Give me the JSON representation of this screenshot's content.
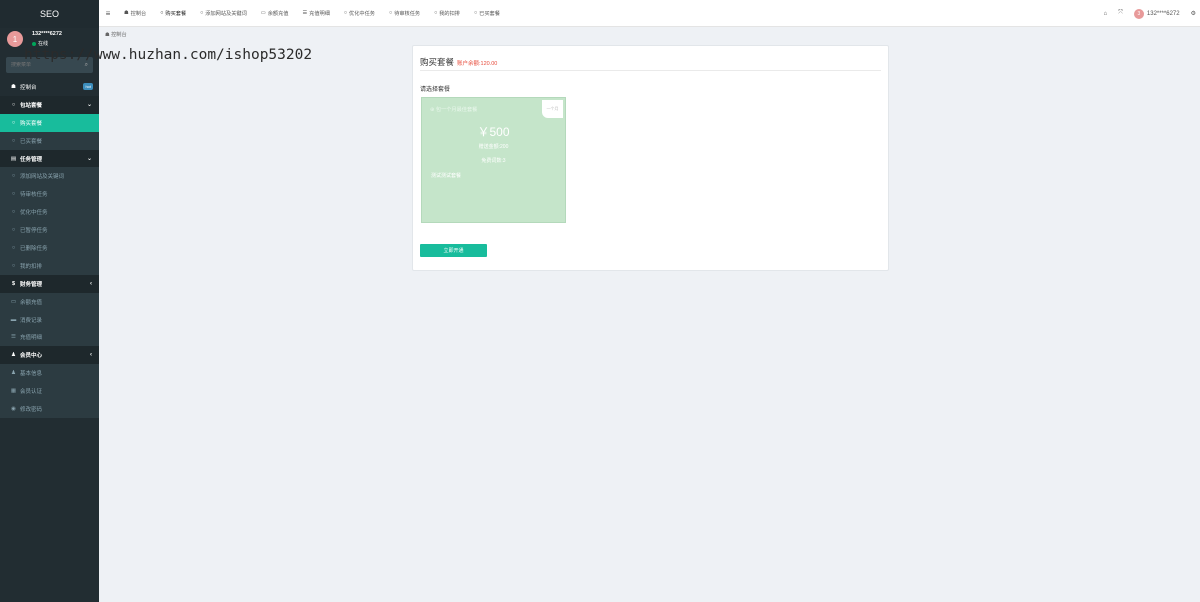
{
  "sidebar": {
    "logo": "SEO",
    "user": {
      "avatar": "1",
      "name": "132****6272",
      "status": "在线"
    },
    "search_placeholder": "搜索菜单",
    "items": [
      {
        "label": "控制台",
        "icon": "dashboard-icon",
        "type": "top",
        "badge": "hot"
      },
      {
        "label": "包站套餐",
        "icon": "circle-icon",
        "type": "header",
        "arrow": "⌄"
      },
      {
        "label": "购买套餐",
        "icon": "circle-icon",
        "type": "active"
      },
      {
        "label": "已买套餐",
        "icon": "circle-icon",
        "type": "sub"
      },
      {
        "label": "任务管理",
        "icon": "list-icon",
        "type": "header",
        "arrow": "⌄"
      },
      {
        "label": "添加网站及关键词",
        "icon": "circle-icon",
        "type": "sub"
      },
      {
        "label": "待审核任务",
        "icon": "circle-icon",
        "type": "sub"
      },
      {
        "label": "优化中任务",
        "icon": "circle-icon",
        "type": "sub"
      },
      {
        "label": "已暂停任务",
        "icon": "circle-icon",
        "type": "sub"
      },
      {
        "label": "已删除任务",
        "icon": "circle-icon",
        "type": "sub"
      },
      {
        "label": "我的扣排",
        "icon": "circle-icon",
        "type": "sub"
      },
      {
        "label": "财务管理",
        "icon": "dollar-icon",
        "type": "header",
        "arrow": "‹"
      },
      {
        "label": "余额充值",
        "icon": "money-icon",
        "type": "sub"
      },
      {
        "label": "消费记录",
        "icon": "card-icon",
        "type": "sub"
      },
      {
        "label": "充值明细",
        "icon": "table-icon",
        "type": "sub"
      },
      {
        "label": "会员中心",
        "icon": "users-icon",
        "type": "header",
        "arrow": "‹"
      },
      {
        "label": "基本信息",
        "icon": "user-icon",
        "type": "sub"
      },
      {
        "label": "会员认证",
        "icon": "idcard-icon",
        "type": "sub"
      },
      {
        "label": "修改密码",
        "icon": "lock-icon",
        "type": "sub"
      }
    ]
  },
  "topnav": {
    "tabs": [
      {
        "label": "控制台",
        "icon": "dashboard-icon"
      },
      {
        "label": "购买套餐",
        "icon": "circle-icon",
        "active": true
      },
      {
        "label": "添加网站及关键词",
        "icon": "circle-icon"
      },
      {
        "label": "余额充值",
        "icon": "money-icon"
      },
      {
        "label": "充值明细",
        "icon": "table-icon"
      },
      {
        "label": "优化中任务",
        "icon": "circle-icon"
      },
      {
        "label": "待审核任务",
        "icon": "circle-icon"
      },
      {
        "label": "我的扣排",
        "icon": "circle-icon"
      },
      {
        "label": "已买套餐",
        "icon": "circle-icon"
      }
    ],
    "right": {
      "avatar": "3",
      "username": "132****6272"
    }
  },
  "breadcrumb": "控制台",
  "watermark": "https://www.huzhan.com/ishop53202",
  "panel": {
    "title": "购买套餐",
    "balance": "账户余额:120.00",
    "choose_label": "请选择套餐",
    "package": {
      "name": "包一个月最佳套餐",
      "tag": "一个月",
      "price": "￥500",
      "line1": "赠送金额:200",
      "line2": "免费词数:3",
      "line3": "测试测试套餐"
    },
    "buy_button": "立即开通"
  },
  "colors": {
    "accent": "#18bc9c",
    "sidebar_bg": "#222d32",
    "card_bg": "#c5e5ca",
    "balance": "#e74c3c"
  }
}
